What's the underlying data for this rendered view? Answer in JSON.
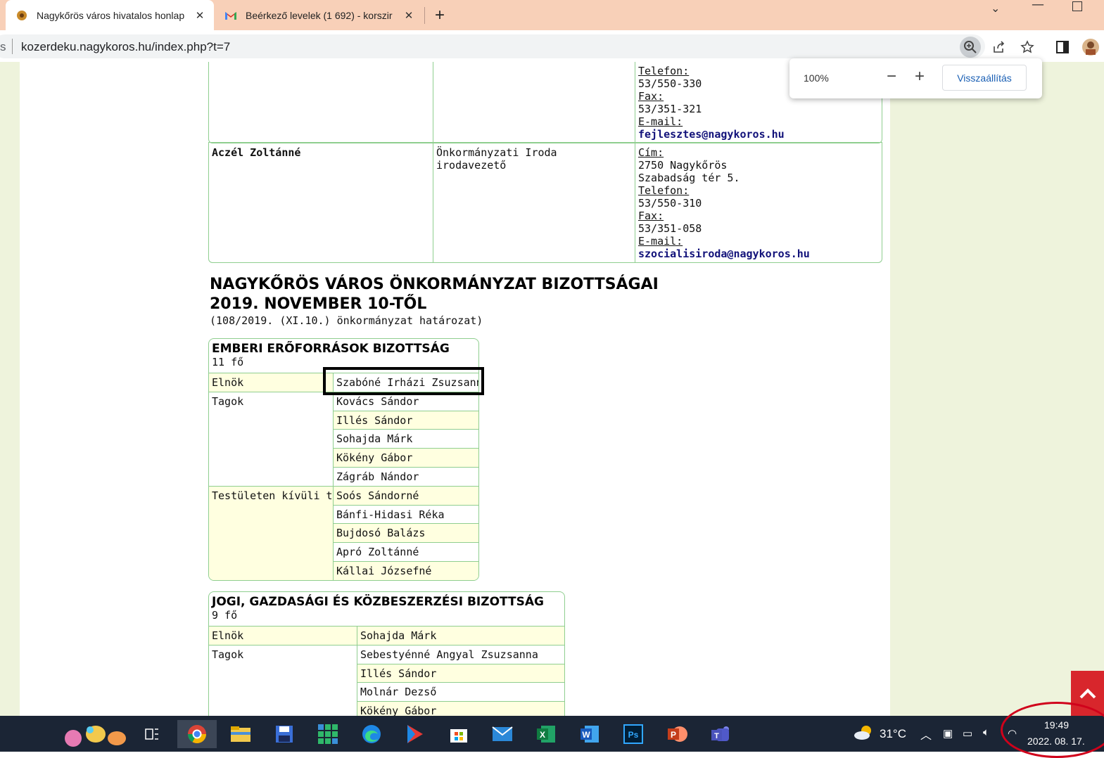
{
  "browser": {
    "tabs": [
      {
        "title": "Nagykőrös város hivatalos honlap",
        "active": true
      },
      {
        "title": "Beérkező levelek (1 692) - korszir",
        "active": false
      }
    ],
    "new_tab_label": "+",
    "url_prefix": "s",
    "url": "kozerdeku.nagykoros.hu/index.php?t=7",
    "zoom_popup": {
      "value": "100%",
      "minus": "−",
      "plus": "+",
      "reset": "Visszaállítás"
    }
  },
  "contacts": [
    {
      "name": "",
      "position": "",
      "lines": [
        "Telefon:",
        "53/550-330",
        "Fax:",
        "53/351-321",
        "E-mail:"
      ],
      "email": "fejlesztes@nagykoros.hu"
    },
    {
      "name": "Aczél Zoltánné",
      "position_line1": "Önkormányzati Iroda",
      "position_line2": "irodavezető",
      "lines": [
        "Cím:",
        "2750 Nagykőrös",
        "Szabadság tér 5.",
        "Telefon:",
        "53/550-310",
        "Fax:",
        "53/351-058",
        "E-mail:"
      ],
      "email": "szocialisiroda@nagykoros.hu"
    }
  ],
  "section": {
    "title_line1": "NAGYKŐRÖS VÁROS ÖNKORMÁNYZAT BIZOTTSÁGAI",
    "title_line2": "2019. NOVEMBER 10-TŐL",
    "subtitle": "(108/2019. (XI.10.) önkormányzat határozat)"
  },
  "committees": [
    {
      "title": "EMBERI ERŐFORRÁSOK BIZOTTSÁG",
      "count": "11 fő",
      "roles": {
        "chair": "Elnök",
        "members": "Tagok",
        "external": "Testületen kívüli tagok"
      },
      "chair": "Szabóné Irházi Zsuzsanna",
      "members": [
        "Kovács Sándor",
        "Illés Sándor",
        "Sohajda Márk",
        "Kökény Gábor",
        "Zágráb Nándor"
      ],
      "external_members": [
        "Soós Sándorné",
        "Bánfi-Hidasi Réka",
        "Bujdosó Balázs",
        "Apró Zoltánné",
        "Kállai Józsefné"
      ]
    },
    {
      "title": "JOGI, GAZDASÁGI ÉS KÖZBESZERZÉSI BIZOTTSÁG",
      "count": "9 fő",
      "roles": {
        "chair": "Elnök",
        "members": "Tagok"
      },
      "chair": "Sohajda Márk",
      "members": [
        "Sebestyénné Angyal Zsuzsanna",
        "Illés Sándor",
        "Molnár Dezső",
        "Kökény Gábor"
      ]
    }
  ],
  "taskbar": {
    "weather": "31°C",
    "time": "19:49",
    "date": "2022. 08. 17."
  },
  "colors": {
    "tabstrip": "#f8d0b8",
    "border_green": "#8fce8f",
    "row_yellow": "#ffffe0",
    "link": "#12127a",
    "taskbar": "#1b2535",
    "annotation_red": "#d0021b"
  }
}
